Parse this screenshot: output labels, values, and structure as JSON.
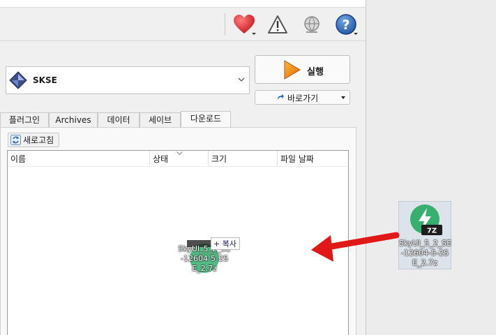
{
  "toolbar": {
    "icons": [
      "heart-icon",
      "warning-icon",
      "globe-icon",
      "help-icon"
    ]
  },
  "profile": {
    "selected": "SKSE"
  },
  "actions": {
    "run_label": "실행",
    "shortcut_label": "바로가기"
  },
  "tabs": [
    {
      "label": "플러그인"
    },
    {
      "label": "Archives"
    },
    {
      "label": "데이터"
    },
    {
      "label": "세이브"
    },
    {
      "label": "다운로드",
      "active": true
    }
  ],
  "downloads": {
    "refresh_label": "새로고침",
    "columns": [
      "이름",
      "상태",
      "크기",
      "파일 날짜"
    ]
  },
  "drag": {
    "file_name": "SkyUI_5_2_SE-12604-5-2SE_2.7z",
    "file_name_line1": "SkyUI_5_2_SE",
    "file_name_line2": "-12604-5-2S",
    "file_name_line3": "E_2.7z",
    "copy_hint": "+ 복사",
    "badge": "7Z"
  },
  "colors": {
    "arrow": "#e01818",
    "archive_green": "#35b06e",
    "run_orange": "#f08a10"
  }
}
